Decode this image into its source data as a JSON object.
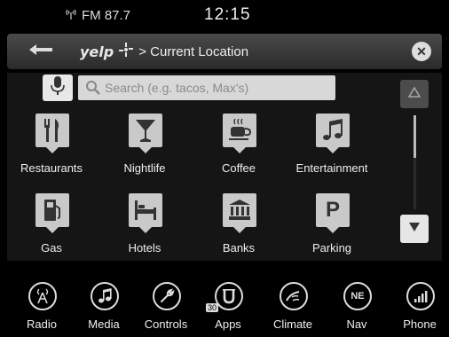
{
  "status": {
    "radio": "FM 87.7",
    "time": "12:15"
  },
  "header": {
    "logo_text": "yelp",
    "title": "> Current Location"
  },
  "search": {
    "placeholder": "Search (e.g. tacos, Max's)"
  },
  "categories": [
    {
      "label": "Restaurants",
      "icon": "fork-knife-icon"
    },
    {
      "label": "Nightlife",
      "icon": "cocktail-icon"
    },
    {
      "label": "Coffee",
      "icon": "coffee-cup-icon"
    },
    {
      "label": "Entertainment",
      "icon": "music-notes-icon"
    },
    {
      "label": "Gas",
      "icon": "gas-pump-icon"
    },
    {
      "label": "Hotels",
      "icon": "bed-icon"
    },
    {
      "label": "Banks",
      "icon": "bank-icon"
    },
    {
      "label": "Parking",
      "icon": "parking-icon",
      "glyph": "P"
    }
  ],
  "scroll": {
    "position_fraction": 0.0
  },
  "nav": [
    {
      "label": "Radio",
      "icon": "radio-icon"
    },
    {
      "label": "Media",
      "icon": "music-note-icon"
    },
    {
      "label": "Controls",
      "icon": "wrench-icon"
    },
    {
      "label": "Apps",
      "icon": "apps-icon",
      "badge": "30"
    },
    {
      "label": "Climate",
      "icon": "climate-icon"
    },
    {
      "label": "Nav",
      "icon": "compass-icon",
      "compass": "NE"
    },
    {
      "label": "Phone",
      "icon": "phone-signal-icon"
    }
  ]
}
